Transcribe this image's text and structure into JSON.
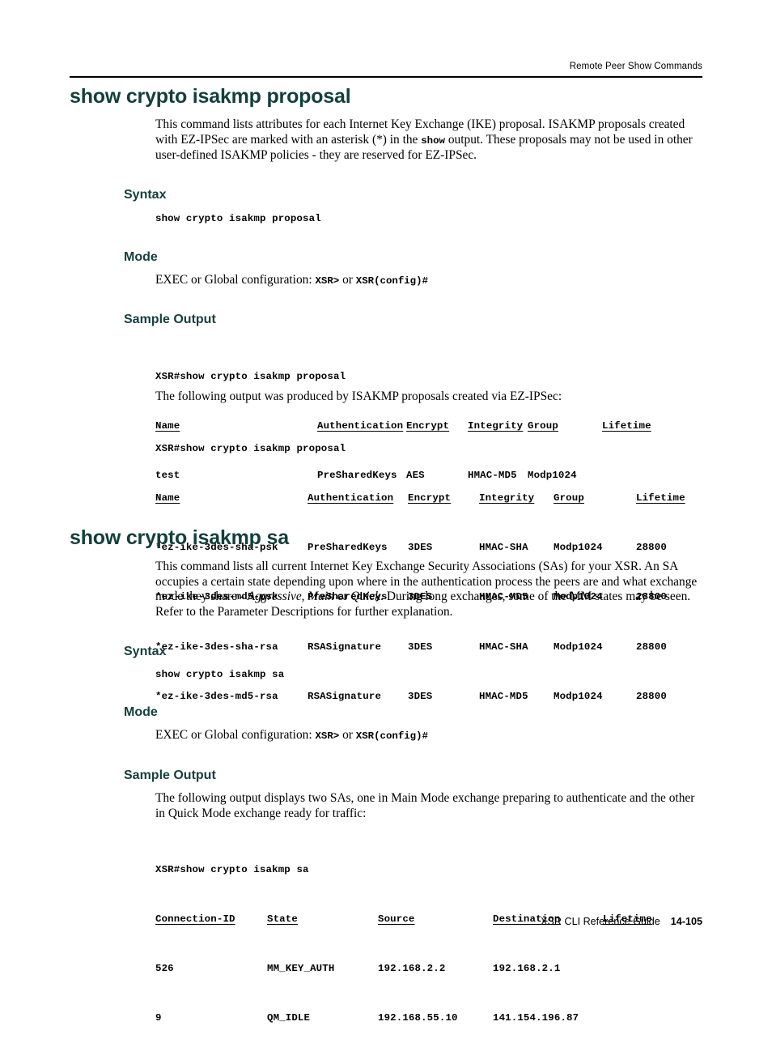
{
  "header": {
    "running_head": "Remote Peer Show Commands"
  },
  "footer": {
    "guide_title": "XSR CLI Reference Guide",
    "page_number": "14-105"
  },
  "colors": {
    "heading": "#133f3d",
    "text": "#000000",
    "rule": "#000000",
    "background": "#ffffff"
  },
  "sections": [
    {
      "title": "show crypto isakmp proposal",
      "description_part1": "This command lists attributes for each Internet Key Exchange (IKE) proposal. ISAKMP proposals created with EZ-IPSec are marked with an asterisk (*) in the ",
      "description_mono": "show",
      "description_part2": " output. These proposals may not be used in other user-defined ISAKMP policies - they are reserved for EZ-IPSec.",
      "syntax_label": "Syntax",
      "syntax_command": "show crypto isakmp proposal",
      "mode_label": "Mode",
      "mode_prefix": "EXEC or Global configuration: ",
      "mode_exec": "XSR>",
      "mode_conjunction": " or ",
      "mode_config": "XSR(config)#",
      "sample_output_label": "Sample Output",
      "prompt1": "XSR#show crypto isakmp proposal",
      "table1": {
        "headers": [
          "Name",
          "Authentication",
          "Encrypt",
          "Integrity",
          "Group",
          "Lifetime"
        ],
        "rows": [
          [
            "test",
            "PreSharedKeys",
            "AES",
            "HMAC-MD5",
            "Modp1024",
            ""
          ]
        ]
      },
      "interstitial": "The following output was produced by ISAKMP proposals created via EZ-IPSec:",
      "prompt2": "XSR#show crypto isakmp proposal",
      "table2": {
        "headers": [
          "Name",
          "Authentication",
          "Encrypt",
          "Integrity",
          "Group",
          "Lifetime"
        ],
        "rows": [
          [
            "*ez-ike-3des-sha-psk",
            "PreSharedKeys",
            "3DES",
            "HMAC-SHA",
            "Modp1024",
            "28800"
          ],
          [
            "*ez-ike-3des-md5-psk",
            "PreSharedKeys",
            "3DES",
            "HMAC-MD5",
            "Modp1024",
            "28800"
          ],
          [
            "*ez-ike-3des-sha-rsa",
            "RSASignature",
            "3DES",
            "HMAC-SHA",
            "Modp1024",
            "28800"
          ],
          [
            "*ez-ike-3des-md5-rsa",
            "RSASignature",
            "3DES",
            "HMAC-MD5",
            "Modp1024",
            "28800"
          ]
        ]
      }
    },
    {
      "title": "show crypto isakmp sa",
      "description_part1": "This command lists all current Internet Key Exchange Security Associations (SAs) for your XSR. An SA occupies a certain state depending upon where in the authentication process the peers are and what exchange mode they share - ",
      "italic1": "Aggressive",
      "sep1": ", ",
      "italic2": "Main",
      "sep2": " or ",
      "italic3": "Quick",
      "description_part2": ". During long exchanges, some of the MM states may be seen. Refer to the Parameter Descriptions for further explanation.",
      "syntax_label": "Syntax",
      "syntax_command": "show crypto isakmp sa",
      "mode_label": "Mode",
      "mode_prefix": "EXEC or Global configuration: ",
      "mode_exec": "XSR>",
      "mode_conjunction": " or ",
      "mode_config": "XSR(config)#",
      "sample_output_label": "Sample Output",
      "sample_intro": "The following output displays two SAs, one in Main Mode exchange preparing to authenticate and the other in Quick Mode exchange ready for traffic:",
      "prompt1": "XSR#show crypto isakmp sa",
      "table1": {
        "headers": [
          "Connection-ID",
          "State",
          "Source",
          "Destination",
          "Lifetime"
        ],
        "rows": [
          [
            "526",
            "MM_KEY_AUTH",
            "192.168.2.2",
            "192.168.2.1",
            ""
          ],
          [
            "9",
            "QM_IDLE",
            "192.168.55.10",
            "141.154.196.87",
            ""
          ]
        ]
      }
    }
  ]
}
